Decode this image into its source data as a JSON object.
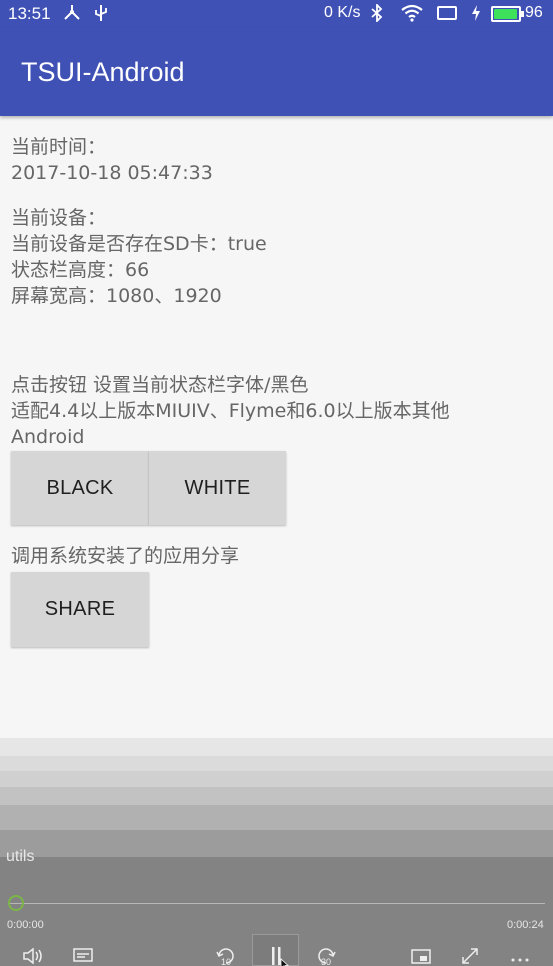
{
  "status_bar": {
    "time": "13:51",
    "network_speed": "0 K/s",
    "battery_level": "96",
    "battery_color": "#3ee25a",
    "icons": [
      "usb-share-icon",
      "usb-icon",
      "bluetooth-icon",
      "wifi-icon",
      "screen-icon",
      "charging-icon",
      "battery-icon"
    ]
  },
  "app_bar": {
    "title": "TSUI-Android",
    "color": "#3f51b5"
  },
  "info": {
    "time_label": "当前时间：",
    "time_value": "2017-10-18 05:47:33",
    "device_label": "当前设备：",
    "sd_card": "当前设备是否存在SD卡：true",
    "status_bar_height": "状态栏高度：66",
    "screen_size": "屏幕宽高：1080、1920"
  },
  "status_font_section": {
    "line1": "点击按钮 设置当前状态栏字体/黑色",
    "line2": "适配4.4以上版本MIUIV、Flyme和6.0以上版本其他",
    "line3": "Android",
    "black_button": "BLACK",
    "white_button": "WHITE"
  },
  "share_section": {
    "label": "调用系统安装了的应用分享",
    "share_button": "SHARE"
  },
  "video_player": {
    "title": "utils",
    "current_time": "0:00:00",
    "duration": "0:00:24",
    "progress_fraction": 0.0,
    "skip_back_seconds": "10",
    "skip_forward_seconds": "30",
    "controls": [
      "volume-icon",
      "captions-icon",
      "skip-back-icon",
      "pause-icon",
      "skip-forward-icon",
      "cast-icon",
      "fullscreen-icon",
      "more-icon"
    ]
  }
}
